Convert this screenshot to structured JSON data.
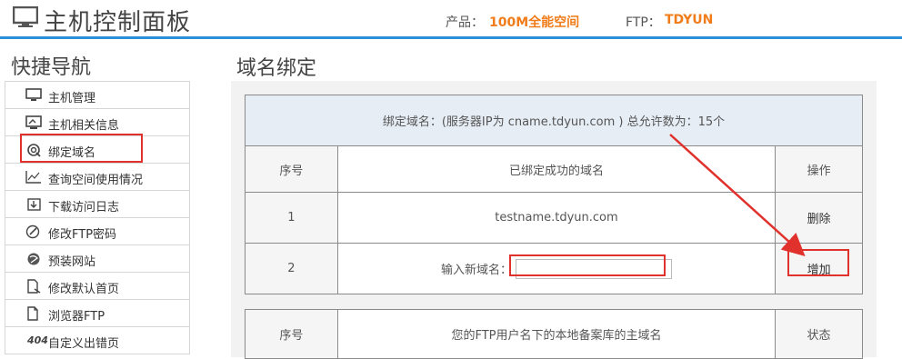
{
  "header": {
    "title": "主机控制面板",
    "product_label": "产品：",
    "product_value": "100M全能空间",
    "ftp_label": "FTP：",
    "ftp_value": "TDYUN"
  },
  "sidebar": {
    "title": "快捷导航",
    "items": [
      {
        "label": "主机管理",
        "icon": "monitor-icon"
      },
      {
        "label": "主机相关信息",
        "icon": "screen-info-icon"
      },
      {
        "label": "绑定域名",
        "icon": "domain-bind-icon"
      },
      {
        "label": "查询空间使用情况",
        "icon": "usage-chart-icon"
      },
      {
        "label": "下载访问日志",
        "icon": "download-log-icon"
      },
      {
        "label": "修改FTP密码",
        "icon": "edit-password-icon"
      },
      {
        "label": "预装网站",
        "icon": "preinstall-site-icon"
      },
      {
        "label": "修改默认首页",
        "icon": "edit-homepage-icon"
      },
      {
        "label": "浏览器FTP",
        "icon": "browser-ftp-icon"
      },
      {
        "label": "自定义出错页",
        "prefix": "404",
        "icon": "error-page-icon"
      }
    ]
  },
  "main": {
    "title": "域名绑定",
    "bind_table": {
      "info": "绑定域名：(服务器IP为 cname.tdyun.com )   总允许数为：15个",
      "headers": [
        "序号",
        "已绑定成功的域名",
        "操作"
      ],
      "rows": [
        {
          "index": "1",
          "domain": "testname.tdyun.com",
          "action": "删除"
        }
      ],
      "new_row": {
        "index": "2",
        "input_label": "输入新域名：",
        "input_value": "",
        "action": "增加"
      }
    },
    "local_table": {
      "headers": [
        "序号",
        "您的FTP用户名下的本地备案库的主域名",
        "状态"
      ]
    }
  },
  "colors": {
    "accent_bar": "#2a8fd6",
    "highlight_orange": "#f07c1a",
    "annotation_red": "#e0312d"
  }
}
